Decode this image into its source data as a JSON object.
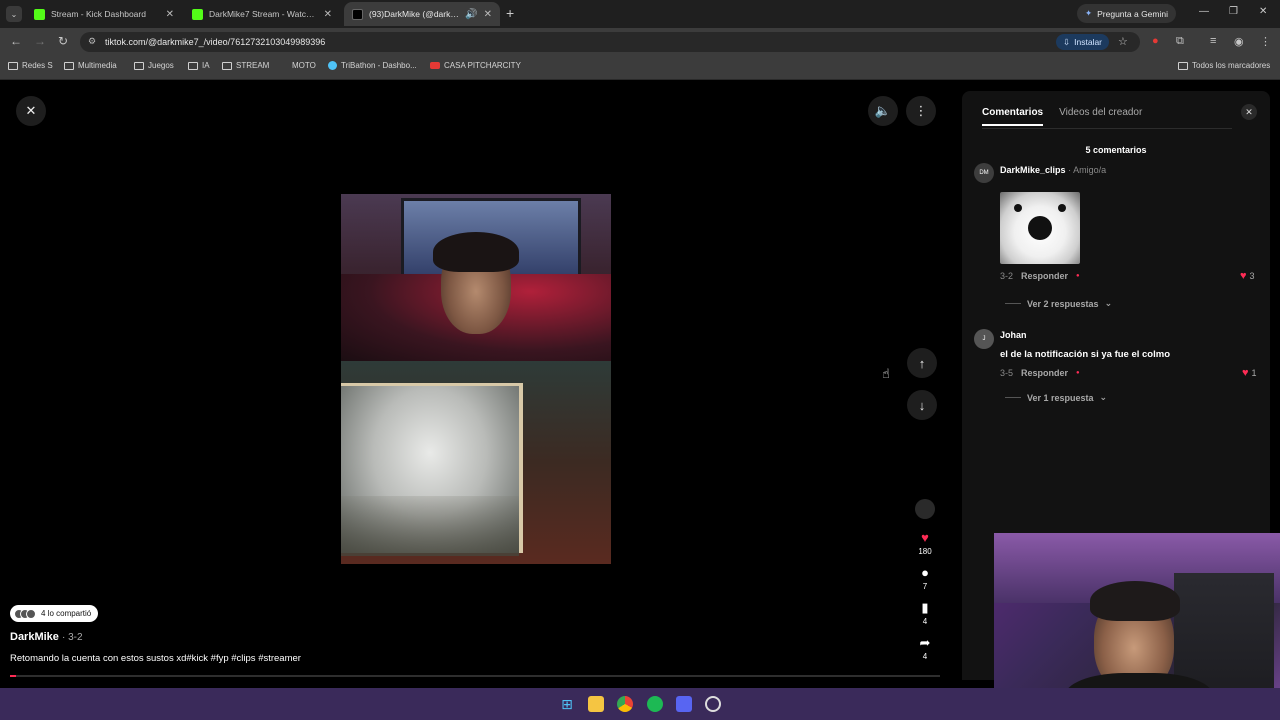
{
  "tabs": [
    {
      "title": "Stream - Kick Dashboard",
      "icon": "kick-icon",
      "color": "#53fc18"
    },
    {
      "title": "DarkMike7 Stream - Watch Live",
      "icon": "kick-icon",
      "color": "#53fc18"
    },
    {
      "title": "(93)DarkMike (@darkmike7",
      "icon": "tiktok-icon",
      "color": "#ffffff",
      "active": true
    }
  ],
  "gemini_label": "Pregunta a Gemini",
  "address_bar": {
    "url": "tiktok.com/@darkmike7_/video/7612732103049989396",
    "install_label": "Instalar"
  },
  "bookmarks": [
    "Redes S",
    "Multimedia",
    "Juegos",
    "IA",
    "STREAM",
    "MOTO",
    "TriBathon - Dashbo...",
    "CASA PITCHARCITY"
  ],
  "all_bookmarks_label": "Todos los marcadores",
  "video": {
    "shared_label": "4 lo compartió",
    "author": "DarkMike",
    "date": "· 3-2",
    "caption": "Retomando la cuenta con estos sustos xd#kick #fyp #clips #streamer",
    "progress": 0.006,
    "actions": {
      "likes": "180",
      "comments": "7",
      "saves": "4",
      "shares": "4"
    }
  },
  "comments_panel": {
    "tab_comments": "Comentarios",
    "tab_creator_videos": "Videos del creador",
    "count_label": "5 comentarios",
    "comments": [
      {
        "user": "DarkMike_clips",
        "badge": "· Amigo/a",
        "text": "",
        "date": "3-2",
        "reply_label": "Responder",
        "likes": "3",
        "replies_label": "Ver 2 respuestas"
      },
      {
        "user": "Johan",
        "badge": "",
        "text": "el de la notificación si ya fue el colmo",
        "date": "3-5",
        "reply_label": "Responder",
        "likes": "1",
        "replies_label": "Ver 1 respuesta"
      }
    ]
  },
  "colors": {
    "accent": "#fe2c55",
    "panel_bg": "#121212",
    "taskbar": "#3a2a5a"
  }
}
